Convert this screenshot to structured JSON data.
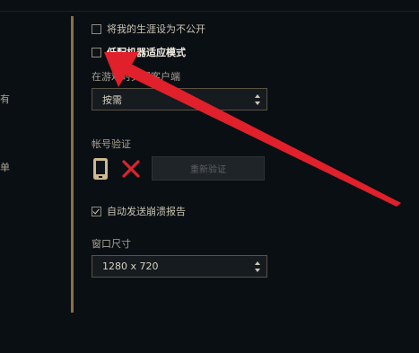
{
  "left_panel": {
    "stub_1": "有",
    "stub_2": "单"
  },
  "settings": {
    "hide_career": {
      "label": "将我的生涯设为不公开",
      "checked": false
    },
    "low_spec_mode": {
      "label": "低配机器适应模式",
      "checked": false
    },
    "close_client_in_game": {
      "label": "在游戏时关闭客户端",
      "value": "按需"
    },
    "account_verify": {
      "label": "帐号验证",
      "button_label": "重新验证"
    },
    "auto_crash_report": {
      "label": "自动发送崩溃报告",
      "checked": true
    },
    "window_size": {
      "label": "窗口尺寸",
      "value": "1280 x 720"
    }
  },
  "colors": {
    "background": "#0a0f14",
    "divider": "#8b6f45",
    "annotation_arrow": "#e0202a",
    "x_mark": "#d8262c",
    "phone_icon": "#cdb890"
  },
  "icons": {
    "phone": "phone-icon",
    "not_verified": "x-icon",
    "select_arrows": "chevron-updown-icon"
  }
}
